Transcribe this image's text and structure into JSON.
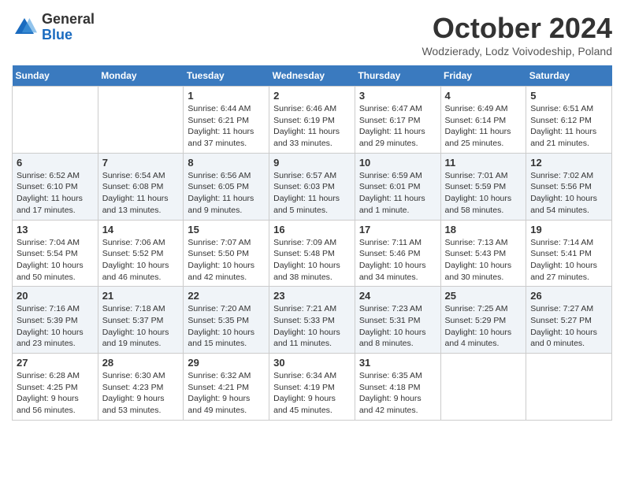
{
  "header": {
    "logo": {
      "general": "General",
      "blue": "Blue"
    },
    "title": "October 2024",
    "subtitle": "Wodzierady, Lodz Voivodeship, Poland"
  },
  "weekdays": [
    "Sunday",
    "Monday",
    "Tuesday",
    "Wednesday",
    "Thursday",
    "Friday",
    "Saturday"
  ],
  "weeks": [
    [
      {
        "day": "",
        "info": ""
      },
      {
        "day": "",
        "info": ""
      },
      {
        "day": "1",
        "info": "Sunrise: 6:44 AM\nSunset: 6:21 PM\nDaylight: 11 hours\nand 37 minutes."
      },
      {
        "day": "2",
        "info": "Sunrise: 6:46 AM\nSunset: 6:19 PM\nDaylight: 11 hours\nand 33 minutes."
      },
      {
        "day": "3",
        "info": "Sunrise: 6:47 AM\nSunset: 6:17 PM\nDaylight: 11 hours\nand 29 minutes."
      },
      {
        "day": "4",
        "info": "Sunrise: 6:49 AM\nSunset: 6:14 PM\nDaylight: 11 hours\nand 25 minutes."
      },
      {
        "day": "5",
        "info": "Sunrise: 6:51 AM\nSunset: 6:12 PM\nDaylight: 11 hours\nand 21 minutes."
      }
    ],
    [
      {
        "day": "6",
        "info": "Sunrise: 6:52 AM\nSunset: 6:10 PM\nDaylight: 11 hours\nand 17 minutes."
      },
      {
        "day": "7",
        "info": "Sunrise: 6:54 AM\nSunset: 6:08 PM\nDaylight: 11 hours\nand 13 minutes."
      },
      {
        "day": "8",
        "info": "Sunrise: 6:56 AM\nSunset: 6:05 PM\nDaylight: 11 hours\nand 9 minutes."
      },
      {
        "day": "9",
        "info": "Sunrise: 6:57 AM\nSunset: 6:03 PM\nDaylight: 11 hours\nand 5 minutes."
      },
      {
        "day": "10",
        "info": "Sunrise: 6:59 AM\nSunset: 6:01 PM\nDaylight: 11 hours\nand 1 minute."
      },
      {
        "day": "11",
        "info": "Sunrise: 7:01 AM\nSunset: 5:59 PM\nDaylight: 10 hours\nand 58 minutes."
      },
      {
        "day": "12",
        "info": "Sunrise: 7:02 AM\nSunset: 5:56 PM\nDaylight: 10 hours\nand 54 minutes."
      }
    ],
    [
      {
        "day": "13",
        "info": "Sunrise: 7:04 AM\nSunset: 5:54 PM\nDaylight: 10 hours\nand 50 minutes."
      },
      {
        "day": "14",
        "info": "Sunrise: 7:06 AM\nSunset: 5:52 PM\nDaylight: 10 hours\nand 46 minutes."
      },
      {
        "day": "15",
        "info": "Sunrise: 7:07 AM\nSunset: 5:50 PM\nDaylight: 10 hours\nand 42 minutes."
      },
      {
        "day": "16",
        "info": "Sunrise: 7:09 AM\nSunset: 5:48 PM\nDaylight: 10 hours\nand 38 minutes."
      },
      {
        "day": "17",
        "info": "Sunrise: 7:11 AM\nSunset: 5:46 PM\nDaylight: 10 hours\nand 34 minutes."
      },
      {
        "day": "18",
        "info": "Sunrise: 7:13 AM\nSunset: 5:43 PM\nDaylight: 10 hours\nand 30 minutes."
      },
      {
        "day": "19",
        "info": "Sunrise: 7:14 AM\nSunset: 5:41 PM\nDaylight: 10 hours\nand 27 minutes."
      }
    ],
    [
      {
        "day": "20",
        "info": "Sunrise: 7:16 AM\nSunset: 5:39 PM\nDaylight: 10 hours\nand 23 minutes."
      },
      {
        "day": "21",
        "info": "Sunrise: 7:18 AM\nSunset: 5:37 PM\nDaylight: 10 hours\nand 19 minutes."
      },
      {
        "day": "22",
        "info": "Sunrise: 7:20 AM\nSunset: 5:35 PM\nDaylight: 10 hours\nand 15 minutes."
      },
      {
        "day": "23",
        "info": "Sunrise: 7:21 AM\nSunset: 5:33 PM\nDaylight: 10 hours\nand 11 minutes."
      },
      {
        "day": "24",
        "info": "Sunrise: 7:23 AM\nSunset: 5:31 PM\nDaylight: 10 hours\nand 8 minutes."
      },
      {
        "day": "25",
        "info": "Sunrise: 7:25 AM\nSunset: 5:29 PM\nDaylight: 10 hours\nand 4 minutes."
      },
      {
        "day": "26",
        "info": "Sunrise: 7:27 AM\nSunset: 5:27 PM\nDaylight: 10 hours\nand 0 minutes."
      }
    ],
    [
      {
        "day": "27",
        "info": "Sunrise: 6:28 AM\nSunset: 4:25 PM\nDaylight: 9 hours\nand 56 minutes."
      },
      {
        "day": "28",
        "info": "Sunrise: 6:30 AM\nSunset: 4:23 PM\nDaylight: 9 hours\nand 53 minutes."
      },
      {
        "day": "29",
        "info": "Sunrise: 6:32 AM\nSunset: 4:21 PM\nDaylight: 9 hours\nand 49 minutes."
      },
      {
        "day": "30",
        "info": "Sunrise: 6:34 AM\nSunset: 4:19 PM\nDaylight: 9 hours\nand 45 minutes."
      },
      {
        "day": "31",
        "info": "Sunrise: 6:35 AM\nSunset: 4:18 PM\nDaylight: 9 hours\nand 42 minutes."
      },
      {
        "day": "",
        "info": ""
      },
      {
        "day": "",
        "info": ""
      }
    ]
  ]
}
